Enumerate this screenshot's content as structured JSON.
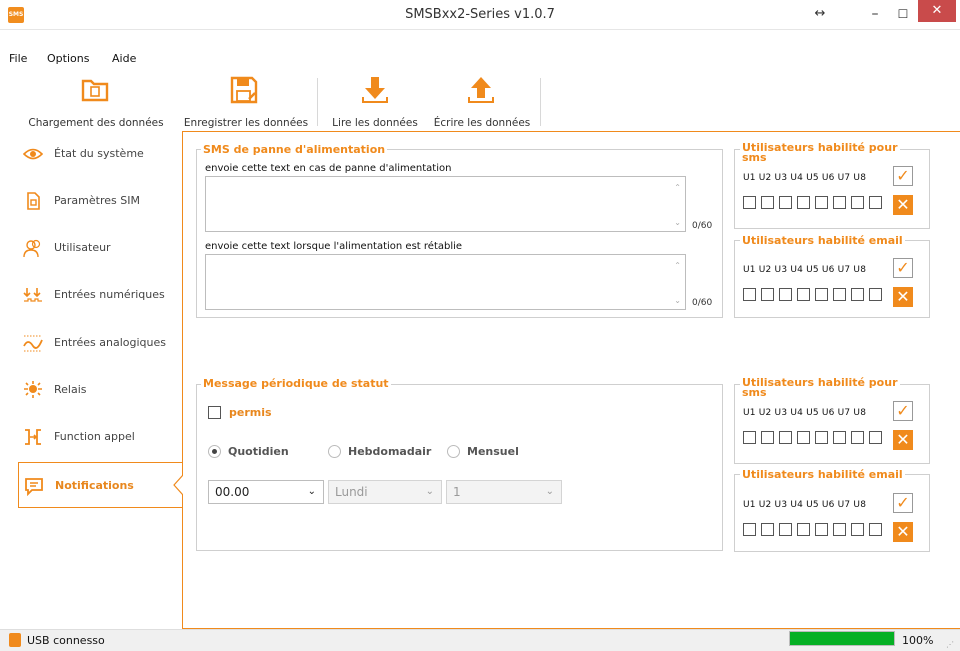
{
  "window": {
    "title": "SMSBxx2-Series v1.0.7",
    "app_icon_text": "SMS",
    "restore_glyph": "↔",
    "min_glyph": "–",
    "max_glyph": "☐",
    "close_glyph": "✕"
  },
  "menu": [
    "File",
    "Options",
    "Aide"
  ],
  "toolbar": [
    {
      "label": "Chargement des données",
      "icon": "folder-icon"
    },
    {
      "label": "Enregistrer les données",
      "icon": "save-icon"
    },
    {
      "label": "Lire les données",
      "icon": "download-icon"
    },
    {
      "label": "Écrire les données",
      "icon": "upload-icon"
    }
  ],
  "sidebar": [
    {
      "label": "État du système",
      "icon": "eye-icon"
    },
    {
      "label": "Paramètres SIM",
      "icon": "sim-icon"
    },
    {
      "label": "Utilisateur",
      "icon": "users-icon"
    },
    {
      "label": "Entrées numériques",
      "icon": "digital-inputs-icon"
    },
    {
      "label": "Entrées analogiques",
      "icon": "analog-inputs-icon"
    },
    {
      "label": "Relais",
      "icon": "relay-icon"
    },
    {
      "label": "Function appel",
      "icon": "call-function-icon"
    },
    {
      "label": "Notifications",
      "icon": "notifications-icon",
      "selected": true
    }
  ],
  "power_sms": {
    "legend": "SMS de panne d'alimentation",
    "text1_label": "envoie cette text en cas de panne d'alimentation",
    "text1_value": "",
    "text1_counter": "0/60",
    "text2_label": "envoie cette text lorsque l'alimentation est rétablie",
    "text2_value": "",
    "text2_counter": "0/60"
  },
  "user_groups": {
    "sms_legend_line1": "Utilisateurs habilité pour",
    "sms_legend_line2": "sms",
    "email_legend": "Utilisateurs habilité email",
    "users_label": "U1 U2 U3 U4 U5 U6 U7 U8",
    "ok_glyph": "✓",
    "x_glyph": "✕"
  },
  "periodic": {
    "legend": "Message périodique de statut",
    "permis_label": "permis",
    "permis_checked": false,
    "radios": [
      {
        "label": "Quotidien",
        "checked": true
      },
      {
        "label": "Hebdomadair",
        "checked": false
      },
      {
        "label": "Mensuel",
        "checked": false
      }
    ],
    "time_value": "00.00",
    "day_value": "Lundi",
    "date_value": "1"
  },
  "status": {
    "text": "USB connesso",
    "progress_value": 1.0,
    "progress_text": "100%",
    "progress_color": "#06b025"
  },
  "colors": {
    "accent": "#f08a1c",
    "close_button": "#c94b4b"
  }
}
